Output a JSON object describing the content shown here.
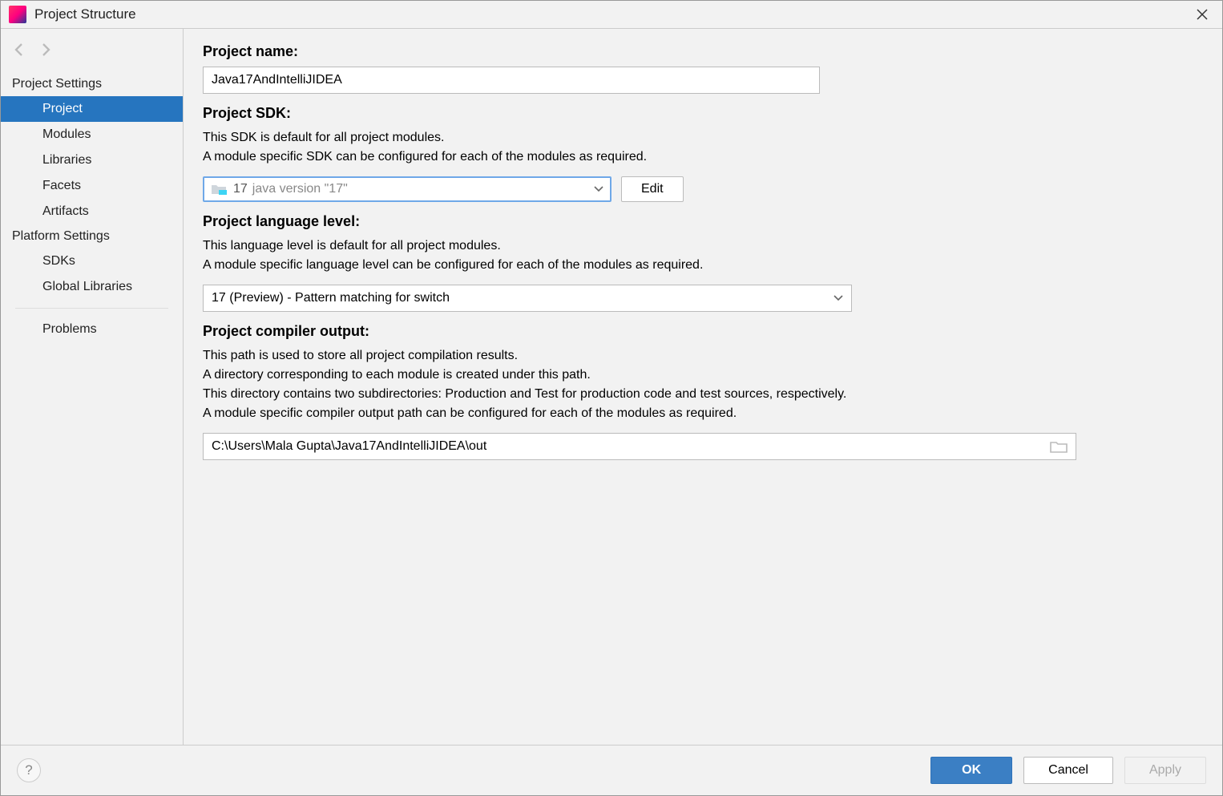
{
  "title": "Project Structure",
  "sidebar": {
    "sections": [
      {
        "title": "Project Settings",
        "items": [
          "Project",
          "Modules",
          "Libraries",
          "Facets",
          "Artifacts"
        ]
      },
      {
        "title": "Platform Settings",
        "items": [
          "SDKs",
          "Global Libraries"
        ]
      }
    ],
    "selected": "Project",
    "problems": "Problems"
  },
  "form": {
    "projectName": {
      "label": "Project name:",
      "value": "Java17AndIntelliJIDEA"
    },
    "projectSdk": {
      "label": "Project SDK:",
      "desc1": "This SDK is default for all project modules.",
      "desc2": "A module specific SDK can be configured for each of the modules as required.",
      "valuePrefix": "17",
      "valueSuffix": "java version \"17\"",
      "editBtn": "Edit"
    },
    "langLevel": {
      "label": "Project language level:",
      "desc1": "This language level is default for all project modules.",
      "desc2": "A module specific language level can be configured for each of the modules as required.",
      "value": "17 (Preview) - Pattern matching for switch"
    },
    "output": {
      "label": "Project compiler output:",
      "desc1": "This path is used to store all project compilation results.",
      "desc2": "A directory corresponding to each module is created under this path.",
      "desc3": "This directory contains two subdirectories: Production and Test for production code and test sources, respectively.",
      "desc4": "A module specific compiler output path can be configured for each of the modules as required.",
      "value": "C:\\Users\\Mala Gupta\\Java17AndIntelliJIDEA\\out"
    }
  },
  "buttons": {
    "ok": "OK",
    "cancel": "Cancel",
    "apply": "Apply"
  }
}
